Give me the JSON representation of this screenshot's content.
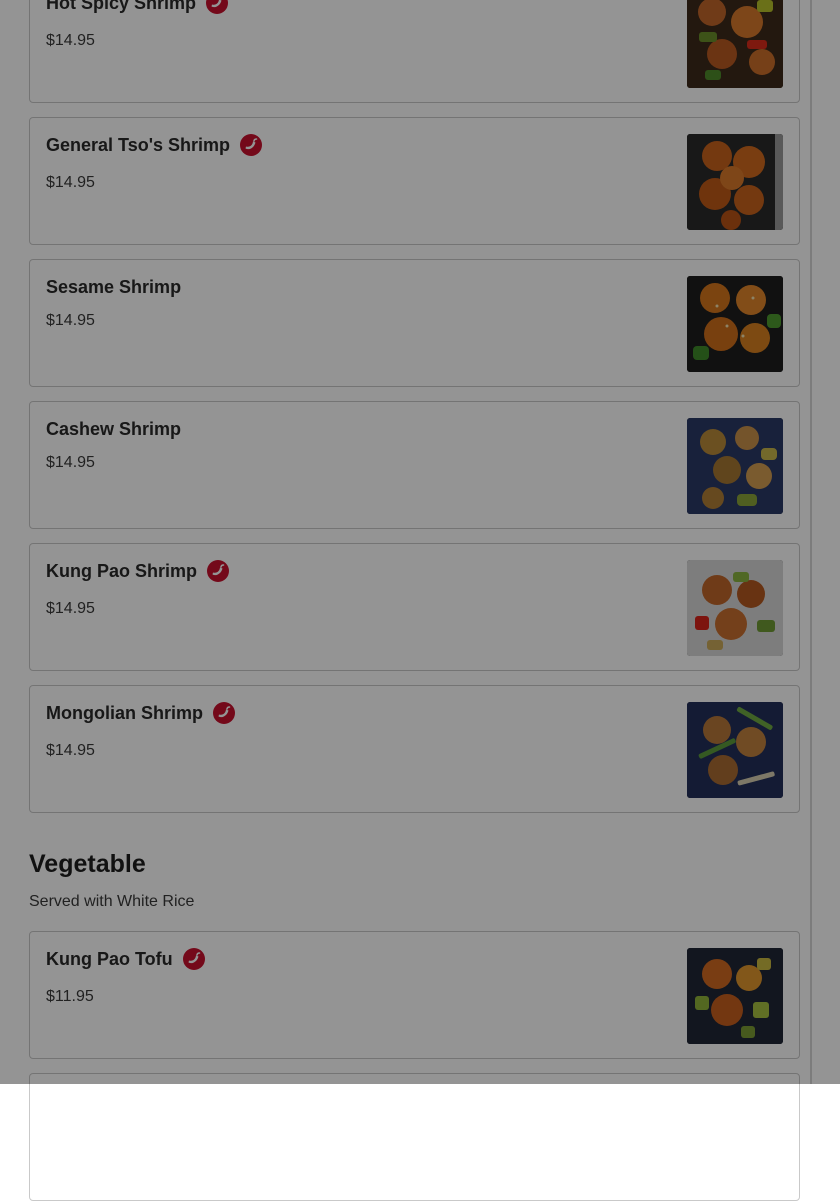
{
  "colors": {
    "spicy_badge": "#c8102e",
    "card_border": "#c9c9c9",
    "overlay": "rgba(0,0,0,0.42)"
  },
  "icons": {
    "spicy": "chili-pepper-icon"
  },
  "menu": {
    "items": [
      {
        "name": "Hot Spicy Shrimp",
        "price": "$14.95",
        "spicy": true
      },
      {
        "name": "General Tso's Shrimp",
        "price": "$14.95",
        "spicy": true
      },
      {
        "name": "Sesame Shrimp",
        "price": "$14.95",
        "spicy": false
      },
      {
        "name": "Cashew Shrimp",
        "price": "$14.95",
        "spicy": false
      },
      {
        "name": "Kung Pao Shrimp",
        "price": "$14.95",
        "spicy": true
      },
      {
        "name": "Mongolian Shrimp",
        "price": "$14.95",
        "spicy": true
      }
    ],
    "vegetable_section": {
      "title": "Vegetable",
      "subtitle": "Served with White Rice",
      "items": [
        {
          "name": "Kung Pao Tofu",
          "price": "$11.95",
          "spicy": true
        }
      ]
    }
  }
}
